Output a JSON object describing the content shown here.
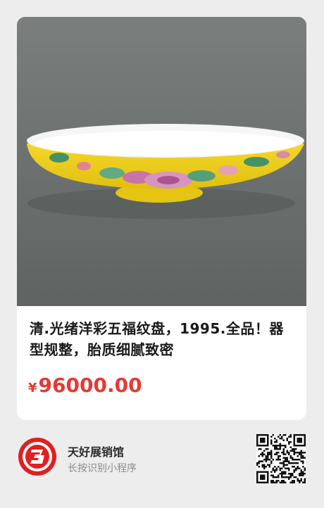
{
  "product": {
    "title": "清.光绪洋彩五福纹盘，1995.全品！器型规整，胎质细腻致密",
    "currency_symbol": "¥",
    "price": "96000.00"
  },
  "shop": {
    "name": "天好展销馆",
    "hint": "长按识别小程序"
  },
  "colors": {
    "price": "#e53935",
    "background": "#ededed",
    "logo_red": "#e02020",
    "plate_yellow": "#f2d21e"
  },
  "icons": {
    "logo": "tianhao-3-logo",
    "qr": "qr-code"
  }
}
